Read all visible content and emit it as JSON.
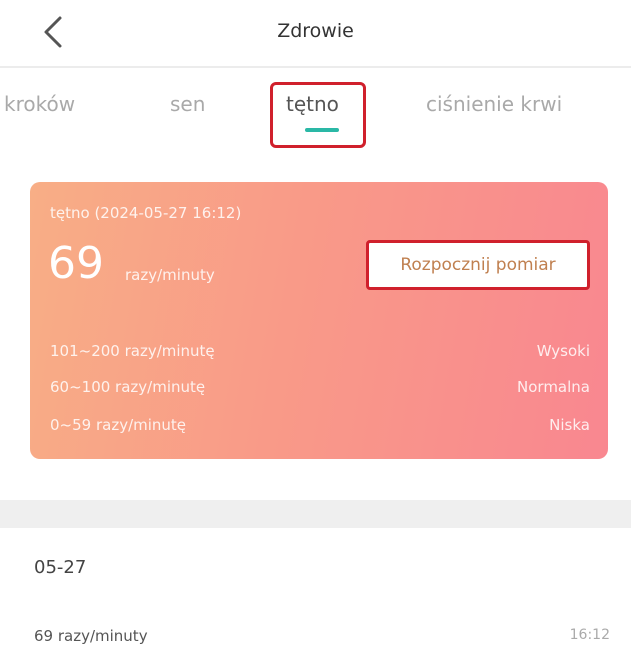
{
  "header": {
    "title": "Zdrowie",
    "back_icon": "chevron-left-icon"
  },
  "tabs": [
    {
      "label": "kroków"
    },
    {
      "label": "sen"
    },
    {
      "label": "tętno",
      "active": true
    },
    {
      "label": "ciśnienie krwi"
    }
  ],
  "colors": {
    "accent": "#2ab8a6",
    "highlight_border": "#d0202c",
    "card_gradient_start": "#f8ae86",
    "card_gradient_end": "#f98790"
  },
  "card": {
    "measurement_time": "tętno (2024-05-27 16:12)",
    "value": "69",
    "unit": "razy/minuty",
    "measure_button": "Rozpocznij pomiar",
    "ranges": [
      {
        "label": "101~200 razy/minutę",
        "status": "Wysoki"
      },
      {
        "label": "60~100 razy/minutę",
        "status": "Normalna"
      },
      {
        "label": "0~59 razy/minutę",
        "status": "Niska"
      }
    ]
  },
  "history": {
    "date": "05-27",
    "entries": [
      {
        "reading": "69 razy/minuty",
        "time": "16:12"
      }
    ]
  }
}
